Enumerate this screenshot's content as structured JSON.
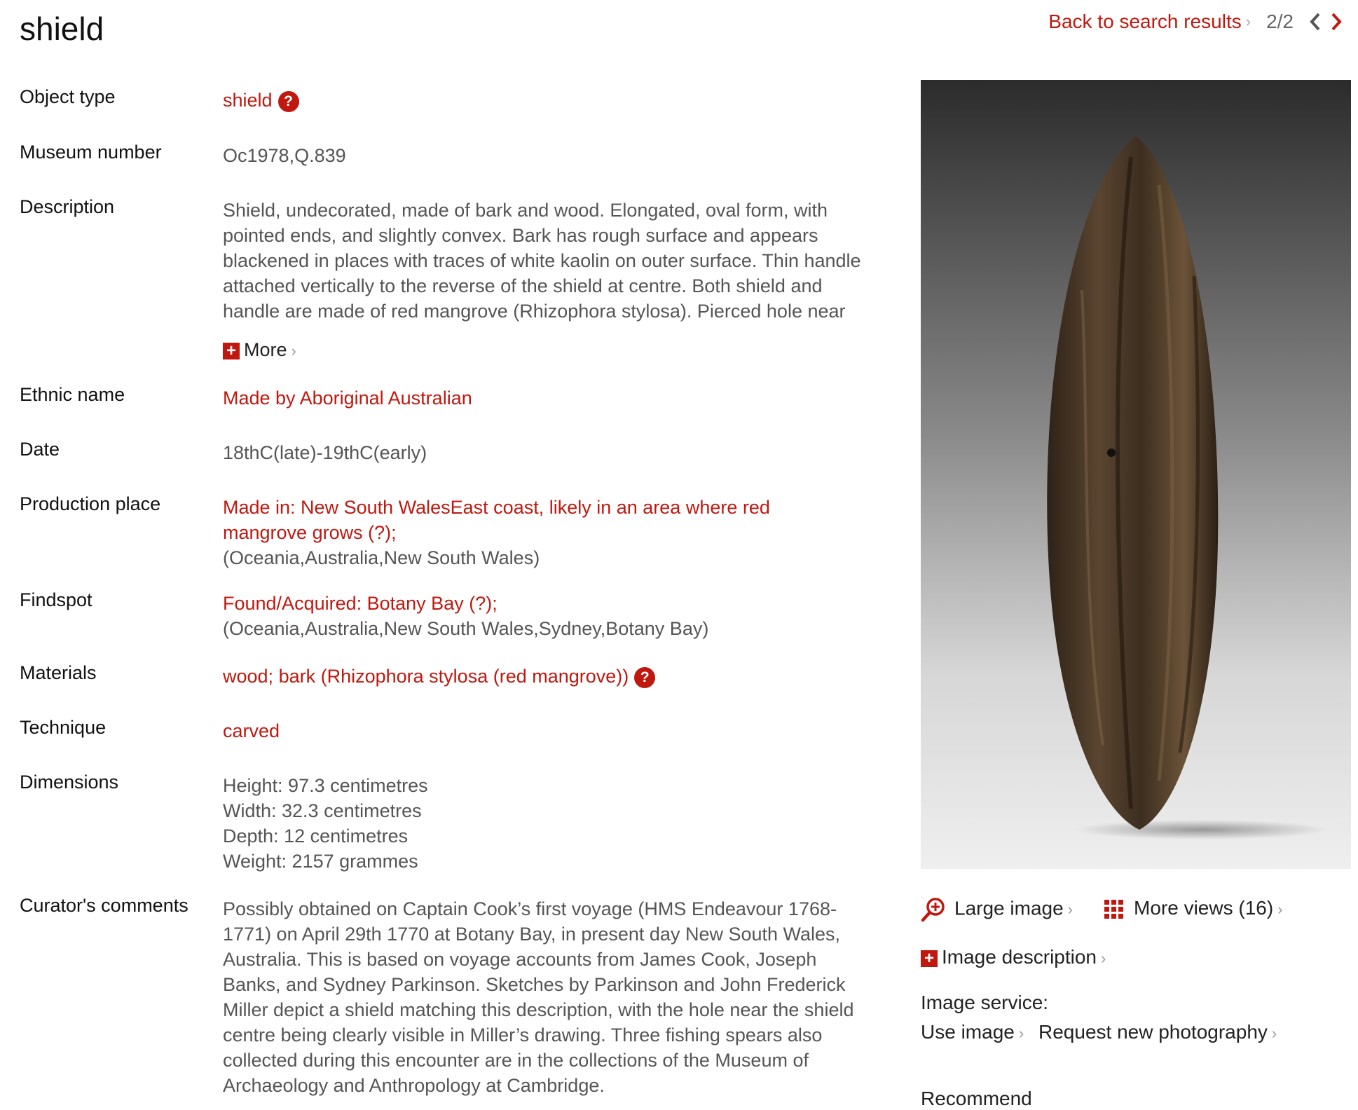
{
  "page": {
    "title": "shield"
  },
  "nav": {
    "back_label": "Back to search results",
    "pager": "2/2"
  },
  "fields": {
    "object_type": {
      "label": "Object type",
      "value": "shield"
    },
    "museum_number": {
      "label": "Museum number",
      "value": "Oc1978,Q.839"
    },
    "description": {
      "label": "Description",
      "lines": [
        "Shield, undecorated, made of bark and wood. Elongated, oval form, with",
        "pointed ends, and slightly convex. Bark has rough surface and appears",
        "blackened in places with traces of white kaolin on outer surface. Thin handle",
        "attached vertically to the reverse of the shield at centre. Both shield and",
        "handle are made of red mangrove (Rhizophora stylosa). Pierced hole near"
      ],
      "more_label": "More"
    },
    "ethnic_name": {
      "label": "Ethnic name",
      "value": "Made by Aboriginal Australian"
    },
    "date": {
      "label": "Date",
      "value": "18thC(late)-19thC(early)"
    },
    "production_place": {
      "label": "Production place",
      "line1": "Made in: New South WalesEast coast, likely in an area where red",
      "line2": "mangrove grows (?)",
      "line2_suffix": ";",
      "line3": "(Oceania,Australia,New South Wales)"
    },
    "findspot": {
      "label": "Findspot",
      "line1": "Found/Acquired: Botany Bay (?)",
      "line1_suffix": ";",
      "line2": "(Oceania,Australia,New South Wales,Sydney,Botany Bay)"
    },
    "materials": {
      "label": "Materials",
      "value1": "wood",
      "sep": ";",
      "value2": "bark (Rhizophora stylosa (red mangrove))"
    },
    "technique": {
      "label": "Technique",
      "value": "carved"
    },
    "dimensions": {
      "label": "Dimensions",
      "lines": [
        "Height: 97.3 centimetres",
        "Width: 32.3 centimetres",
        "Depth: 12 centimetres",
        "Weight: 2157 grammes"
      ]
    },
    "curators_comments": {
      "label": "Curator's comments",
      "lines": [
        "Possibly obtained on Captain Cook’s first voyage (HMS Endeavour 1768-",
        "1771) on April 29th 1770 at Botany Bay, in present day New South Wales,",
        "Australia. This is based on voyage accounts from James Cook, Joseph",
        "Banks, and Sydney Parkinson. Sketches by Parkinson and John Frederick",
        "Miller depict a shield matching this description, with the hole near the shield",
        "centre being clearly visible in Miller’s drawing. Three fishing spears also",
        "collected during this encounter are in the collections of the Museum of",
        "Archaeology and Anthropology at Cambridge."
      ]
    }
  },
  "image_panel": {
    "large_image": "Large image",
    "more_views": "More views (16)",
    "image_description": "Image description",
    "image_service": "Image service:",
    "use_image": "Use image",
    "request_photo": "Request new photography",
    "recommend": "Recommend"
  },
  "colors": {
    "accent": "#c0180f",
    "text": "#555555",
    "label": "#111111"
  }
}
